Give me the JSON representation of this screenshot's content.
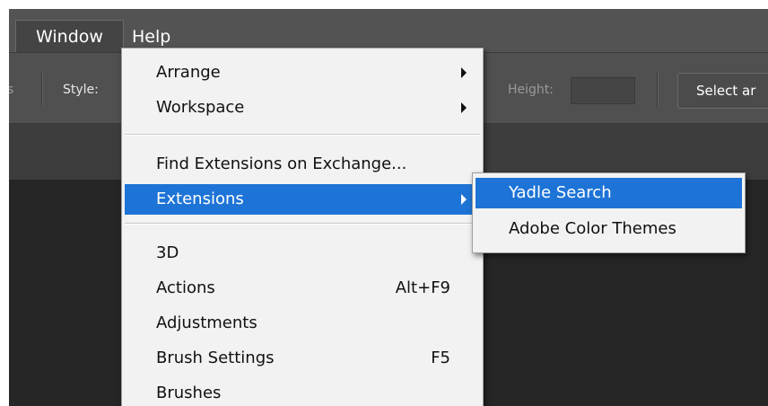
{
  "menubar": {
    "items": [
      {
        "label": "Window",
        "active": true
      },
      {
        "label": "Help",
        "active": false
      }
    ]
  },
  "options_bar": {
    "partial_left": "s",
    "style_label": "Style:",
    "height_label": "Height:",
    "height_value": "",
    "select_button": "Select ar"
  },
  "window_menu": {
    "group1": [
      {
        "label": "Arrange",
        "submenu": true
      },
      {
        "label": "Workspace",
        "submenu": true
      }
    ],
    "group2": [
      {
        "label": "Find Extensions on Exchange...",
        "submenu": false
      },
      {
        "label": "Extensions",
        "submenu": true,
        "highlighted": true
      }
    ],
    "group3": [
      {
        "label": "3D",
        "shortcut": ""
      },
      {
        "label": "Actions",
        "shortcut": "Alt+F9"
      },
      {
        "label": "Adjustments",
        "shortcut": ""
      },
      {
        "label": "Brush Settings",
        "shortcut": "F5"
      },
      {
        "label": "Brushes",
        "shortcut": ""
      }
    ]
  },
  "extensions_submenu": {
    "items": [
      {
        "label": "Yadle Search",
        "highlighted": true
      },
      {
        "label": "Adobe Color Themes",
        "highlighted": false
      }
    ]
  },
  "colors": {
    "highlight": "#1e74d6",
    "menu_bg": "#f2f2f2",
    "app_bar": "#535353"
  }
}
